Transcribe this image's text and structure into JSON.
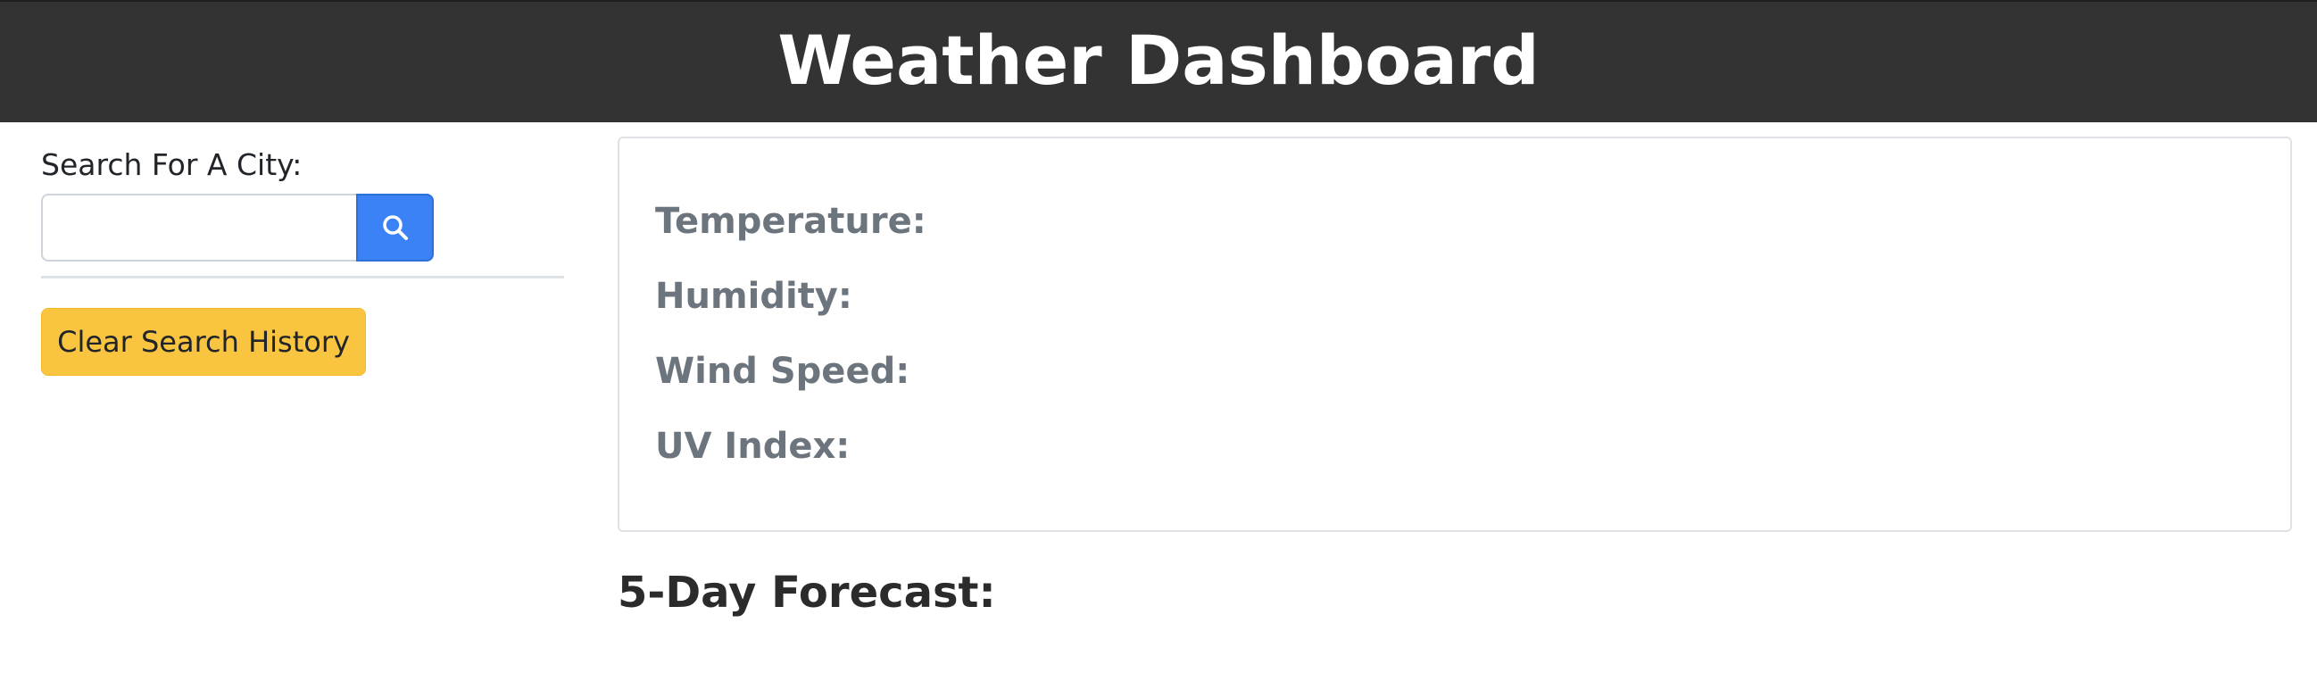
{
  "header": {
    "title": "Weather Dashboard",
    "background_color": "#333333"
  },
  "sidebar": {
    "search_label": "Search For A City:",
    "search_input": {
      "value": "",
      "placeholder": ""
    },
    "search_button_icon": "search-icon",
    "search_button_color": "#3b82f6",
    "clear_button_label": "Clear Search History",
    "clear_button_color": "#f9c440"
  },
  "current_weather": {
    "temperature_label": "Temperature:",
    "humidity_label": "Humidity:",
    "wind_speed_label": "Wind Speed:",
    "uv_index_label": "UV Index:"
  },
  "forecast": {
    "heading": "5-Day Forecast:"
  }
}
